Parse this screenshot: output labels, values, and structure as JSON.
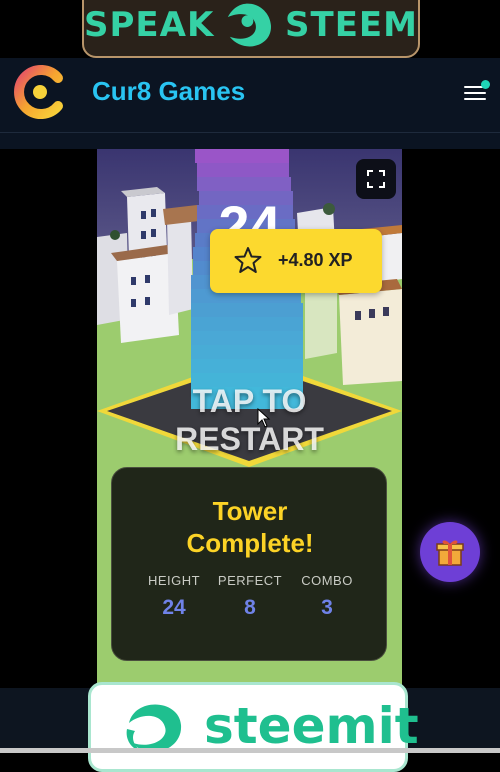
{
  "banner": {
    "left_word": "SPEAK",
    "right_word": "STEEM"
  },
  "header": {
    "title": "Cur8 Games"
  },
  "game": {
    "score": "24",
    "xp_badge": "+4.80 XP",
    "restart_line1": "TAP TO",
    "restart_line2": "RESTART",
    "result": {
      "title_line1": "Tower",
      "title_line2": "Complete!",
      "stats": [
        {
          "label": "HEIGHT",
          "value": "24"
        },
        {
          "label": "PERFECT",
          "value": "8"
        },
        {
          "label": "COMBO",
          "value": "3"
        }
      ]
    }
  },
  "bottom_banner": {
    "word": "steemit"
  },
  "colors": {
    "accent": "#29c4f2",
    "xp": "#fcd92e",
    "title_yellow": "#fcd326",
    "stat_value": "#6f82e8",
    "steem_green": "#35d1a5"
  }
}
